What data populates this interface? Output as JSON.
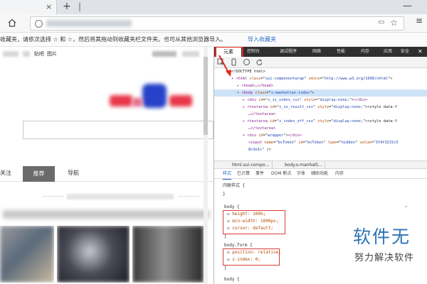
{
  "browser": {
    "tab_close": "×",
    "new_tab": "+",
    "tabstrip_indicator": "|",
    "window_control": "—",
    "menu": "≡"
  },
  "favbar": {
    "text": "收藏夹，请依次选择 ☆ 和 ☆，然后将其拖动到收藏夹栏文件夹。也可从其他浏览器导入。",
    "link": "导入收藏夹"
  },
  "page": {
    "nav_items": [
      "贴吧",
      "图片"
    ],
    "tabs": {
      "follow": "关注",
      "recommend": "推荐",
      "nav": "导航"
    }
  },
  "devtools": {
    "tabs": [
      "元素",
      "控制台",
      "调试程序",
      "网络",
      "性能",
      "内存",
      "应用",
      "安全"
    ],
    "close": "✕",
    "dom_lines": [
      {
        "indent": 0,
        "parts": [
          [
            "plain",
            "<!DOCTYPE html>"
          ]
        ],
        "selected": false
      },
      {
        "indent": 0,
        "parts": [
          [
            "tag",
            "▾ <html "
          ],
          [
            "attr",
            "class"
          ],
          [
            "plain",
            "=\""
          ],
          [
            "val",
            "sui-componentwrap"
          ],
          [
            "plain",
            "\" "
          ],
          [
            "attr",
            "xmlns"
          ],
          [
            "plain",
            "=\""
          ],
          [
            "val",
            "http://www.w3.org/1999/xhtml"
          ],
          [
            "plain",
            "\">"
          ]
        ],
        "selected": false
      },
      {
        "indent": 1,
        "parts": [
          [
            "tag",
            "▸ <head>"
          ],
          [
            "plain",
            "…"
          ],
          [
            "tag",
            "</head>"
          ]
        ],
        "selected": false
      },
      {
        "indent": 1,
        "parts": [
          [
            "tag",
            "▾ <body "
          ],
          [
            "attr",
            "class"
          ],
          [
            "plain",
            "=\""
          ],
          [
            "val",
            "s-manhattan-index"
          ],
          [
            "plain",
            "\">"
          ]
        ],
        "selected": true
      },
      {
        "indent": 2,
        "parts": [
          [
            "tag",
            "▸ <div "
          ],
          [
            "attr",
            "id"
          ],
          [
            "plain",
            "=\""
          ],
          [
            "val",
            "s_is_index_css"
          ],
          [
            "plain",
            "\" "
          ],
          [
            "attr",
            "style"
          ],
          [
            "plain",
            "=\""
          ],
          [
            "val",
            "display:none;"
          ],
          [
            "plain",
            "\">"
          ],
          [
            "tag",
            "</div>"
          ]
        ],
        "selected": false
      },
      {
        "indent": 2,
        "parts": [
          [
            "tag",
            "▸ <textarea "
          ],
          [
            "attr",
            "id"
          ],
          [
            "plain",
            "=\""
          ],
          [
            "val",
            "s_is_result_css"
          ],
          [
            "plain",
            "\" "
          ],
          [
            "attr",
            "style"
          ],
          [
            "plain",
            "=\""
          ],
          [
            "val",
            "display:none;"
          ],
          [
            "plain",
            "\"><style data-f"
          ]
        ],
        "selected": false
      },
      {
        "indent": 3,
        "parts": [
          [
            "plain",
            "…"
          ],
          [
            "tag",
            "</textarea>"
          ]
        ],
        "selected": false
      },
      {
        "indent": 2,
        "parts": [
          [
            "tag",
            "▸ <textarea "
          ],
          [
            "attr",
            "id"
          ],
          [
            "plain",
            "=\""
          ],
          [
            "val",
            "s_index_off_css"
          ],
          [
            "plain",
            "\" "
          ],
          [
            "attr",
            "style"
          ],
          [
            "plain",
            "=\""
          ],
          [
            "val",
            "display:none;"
          ],
          [
            "plain",
            "\"><style data-f"
          ]
        ],
        "selected": false
      },
      {
        "indent": 3,
        "parts": [
          [
            "plain",
            "…"
          ],
          [
            "tag",
            "</textarea>"
          ]
        ],
        "selected": false
      },
      {
        "indent": 2,
        "parts": [
          [
            "tag",
            "▾ <div "
          ],
          [
            "attr",
            "id"
          ],
          [
            "plain",
            "=\""
          ],
          [
            "val",
            "wrapper"
          ],
          [
            "plain",
            "\">"
          ],
          [
            "tag",
            "</div>"
          ]
        ],
        "selected": false
      },
      {
        "indent": 3,
        "parts": [
          [
            "tag",
            "<input "
          ],
          [
            "attr",
            "name"
          ],
          [
            "plain",
            "=\""
          ],
          [
            "val",
            "bsToken"
          ],
          [
            "plain",
            "\" "
          ],
          [
            "attr",
            "id"
          ],
          [
            "plain",
            "=\""
          ],
          [
            "val",
            "bsToken"
          ],
          [
            "plain",
            "\" "
          ],
          [
            "attr",
            "type"
          ],
          [
            "plain",
            "=\""
          ],
          [
            "val",
            "hidden"
          ],
          [
            "plain",
            "\" "
          ],
          [
            "attr",
            "value"
          ],
          [
            "plain",
            "=\""
          ],
          [
            "val",
            "3f4f3215c5"
          ]
        ],
        "selected": false
      },
      {
        "indent": 3,
        "parts": [
          [
            "val",
            "8c3e1c"
          ],
          [
            "plain",
            "\" />"
          ]
        ],
        "selected": false
      }
    ],
    "crumbs": [
      "html.sui-compo…",
      "body.s-manhatt…"
    ],
    "style_tabs": [
      "样式",
      "已计算",
      "事件",
      "DOM 断点",
      "字体",
      "辅助功能",
      "内存"
    ],
    "styles": {
      "inline_label": "内联样式 {",
      "inline_close": "}",
      "body_rule": "body {",
      "body_props": [
        "height: 100%;",
        "min-width: 1000px;",
        "cursor: default;"
      ],
      "body_close": "}",
      "form_rule": "body.form {",
      "form_props": [
        "position: relative;",
        "z-index: 0;"
      ],
      "form_close": "}",
      "last_rule": "body {"
    }
  },
  "watermark": {
    "title": "软件无",
    "subtitle": "努力解决软件"
  }
}
